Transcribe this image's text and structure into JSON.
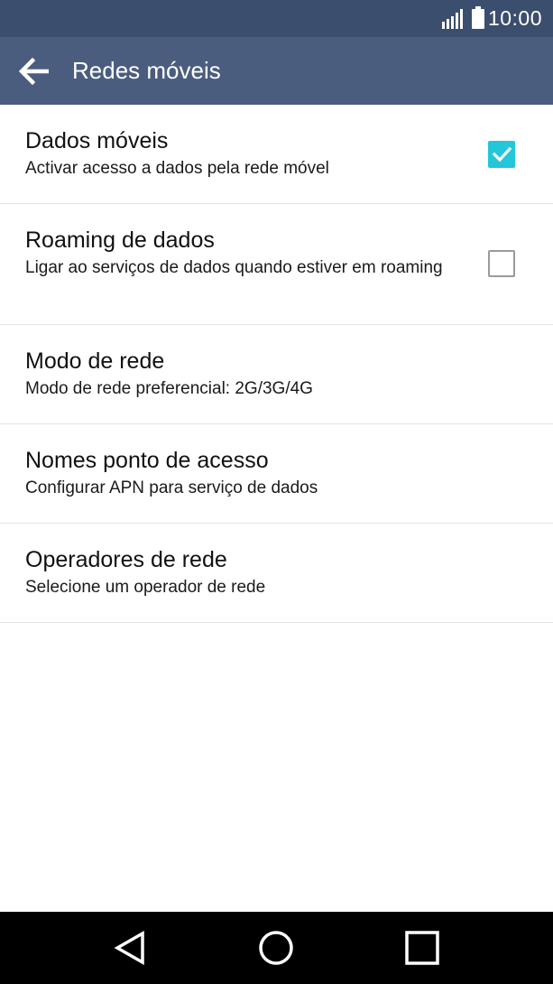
{
  "status_bar": {
    "time": "10:00",
    "signal_icon": "signal-icon",
    "battery_icon": "battery-icon"
  },
  "app_bar": {
    "title": "Redes móveis",
    "back_icon": "arrow-left-icon"
  },
  "settings": [
    {
      "title": "Dados móveis",
      "subtitle": "Activar acesso a dados pela rede móvel",
      "checkbox": "checked"
    },
    {
      "title": "Roaming de dados",
      "subtitle": "Ligar ao serviços de dados quando estiver em roaming",
      "checkbox": "unchecked"
    },
    {
      "title": "Modo de rede",
      "subtitle": "Modo de rede preferencial: 2G/3G/4G"
    },
    {
      "title": "Nomes ponto de acesso",
      "subtitle": "Configurar APN para serviço de dados"
    },
    {
      "title": "Operadores de rede",
      "subtitle": "Selecione um operador de rede"
    }
  ],
  "nav_bar": {
    "back_icon": "triangle-back-icon",
    "home_icon": "circle-home-icon",
    "recents_icon": "square-recents-icon"
  },
  "colors": {
    "status_bar": "#3c4e6d",
    "app_bar": "#4a5d7e",
    "accent": "#24c6d9"
  }
}
